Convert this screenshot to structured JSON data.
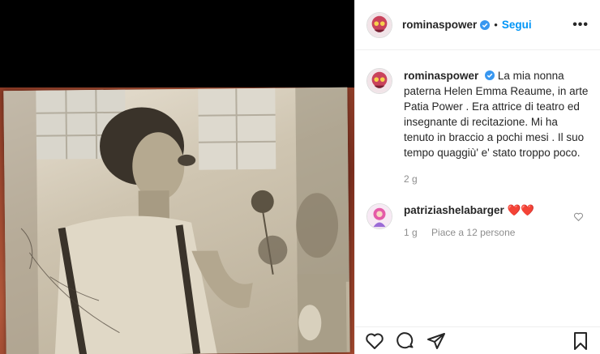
{
  "post": {
    "username": "rominaspower",
    "follow_label": "Segui",
    "dot": "•",
    "more_label": "•••",
    "caption": "La mia nonna paterna Helen Emma Reaume, in arte Patia Power . Era attrice di teatro ed insegnante di recitazione. Mi ha tenuto in braccio a pochi mesi . Il suo tempo quaggiù' e' stato troppo poco.",
    "caption_age": "2 g"
  },
  "reply": {
    "username": "patriziashelabarger",
    "text": "❤️❤️",
    "age": "1 g",
    "likes": "Piace a 12 persone"
  },
  "colors": {
    "link_blue": "#0095f6",
    "verified_blue": "#3897f0",
    "meta_gray": "#8e8e8e"
  },
  "icons": [
    "verified-badge-icon",
    "heart-icon",
    "comment-icon",
    "share-icon",
    "bookmark-icon",
    "more-options-icon"
  ]
}
